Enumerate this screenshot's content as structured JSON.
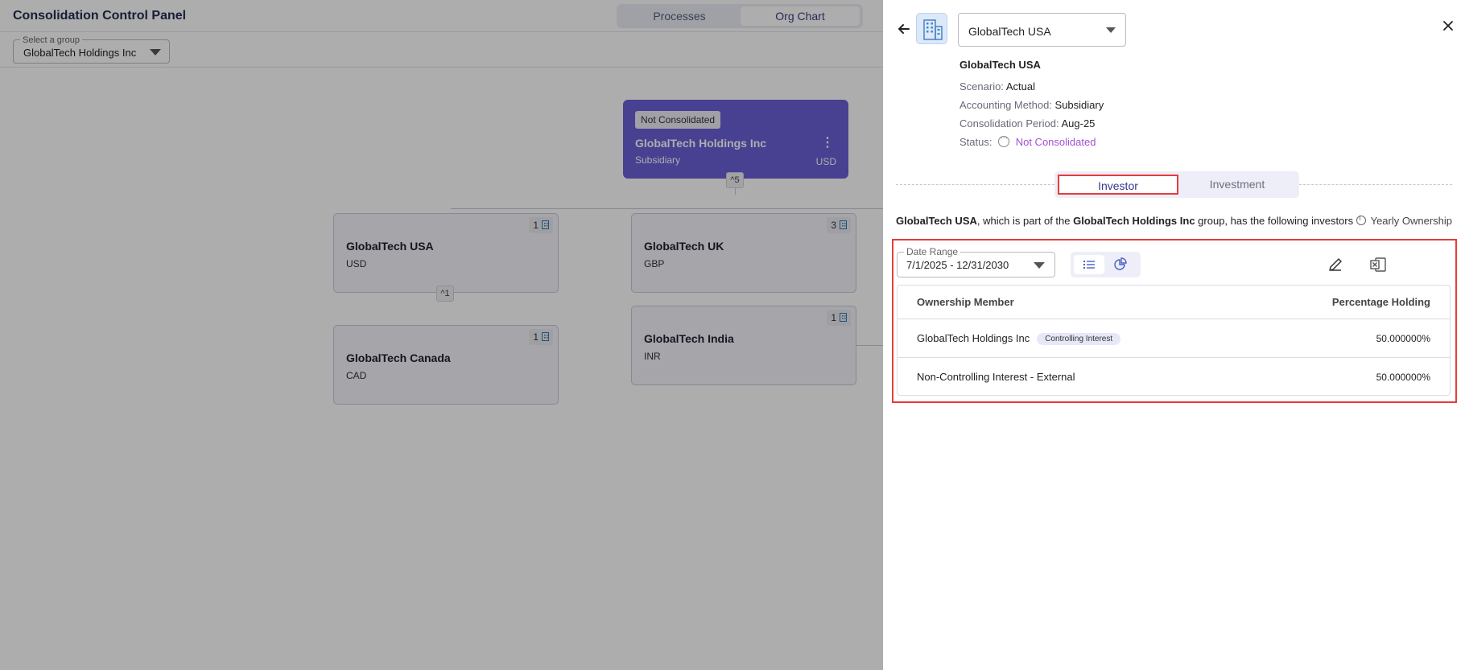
{
  "app": {
    "title": "Consolidation Control Panel",
    "view_tabs": [
      "Processes",
      "Org Chart"
    ],
    "group_select": {
      "label": "Select a group",
      "value": "GlobalTech Holdings Inc"
    }
  },
  "org_chart": {
    "root": {
      "status": "Not Consolidated",
      "name": "GlobalTech Holdings Inc",
      "type": "Subsidiary",
      "currency": "USD",
      "children_count": "^5"
    },
    "nodes": [
      {
        "name": "GlobalTech USA",
        "currency": "USD",
        "count": "1",
        "children_count": "^1"
      },
      {
        "name": "GlobalTech UK",
        "currency": "GBP",
        "count": "3"
      },
      {
        "name": "GlobalTech Canada",
        "currency": "CAD",
        "count": "1"
      },
      {
        "name": "GlobalTech India",
        "currency": "INR",
        "count": "1"
      }
    ]
  },
  "panel": {
    "entity_select_value": "GlobalTech USA",
    "entity_name": "GlobalTech USA",
    "details": {
      "scenario_label": "Scenario:",
      "scenario": "Actual",
      "method_label": "Accounting Method:",
      "method": "Subsidiary",
      "period_label": "Consolidation Period:",
      "period": "Aug-25",
      "status_label": "Status:",
      "status": "Not Consolidated"
    },
    "tabs": {
      "investor": "Investor",
      "investment": "Investment"
    },
    "sentence": {
      "entity": "GlobalTech USA",
      "mid": ", which is part of the ",
      "group": "GlobalTech Holdings Inc",
      "end": " group, has the following investors"
    },
    "yearly_ownership": "Yearly Ownership",
    "date_range": {
      "label": "Date Range",
      "value": "7/1/2025 - 12/31/2030"
    },
    "table": {
      "headers": {
        "member": "Ownership Member",
        "pct": "Percentage Holding"
      },
      "rows": [
        {
          "member": "GlobalTech Holdings Inc",
          "chip": "Controlling Interest",
          "pct": "50.000000%"
        },
        {
          "member": "Non-Controlling Interest - External",
          "pct": "50.000000%"
        }
      ]
    }
  },
  "colors": {
    "accent": "#6a5fd6",
    "highlight": "#e53d3d",
    "status": "#a34fd4"
  }
}
